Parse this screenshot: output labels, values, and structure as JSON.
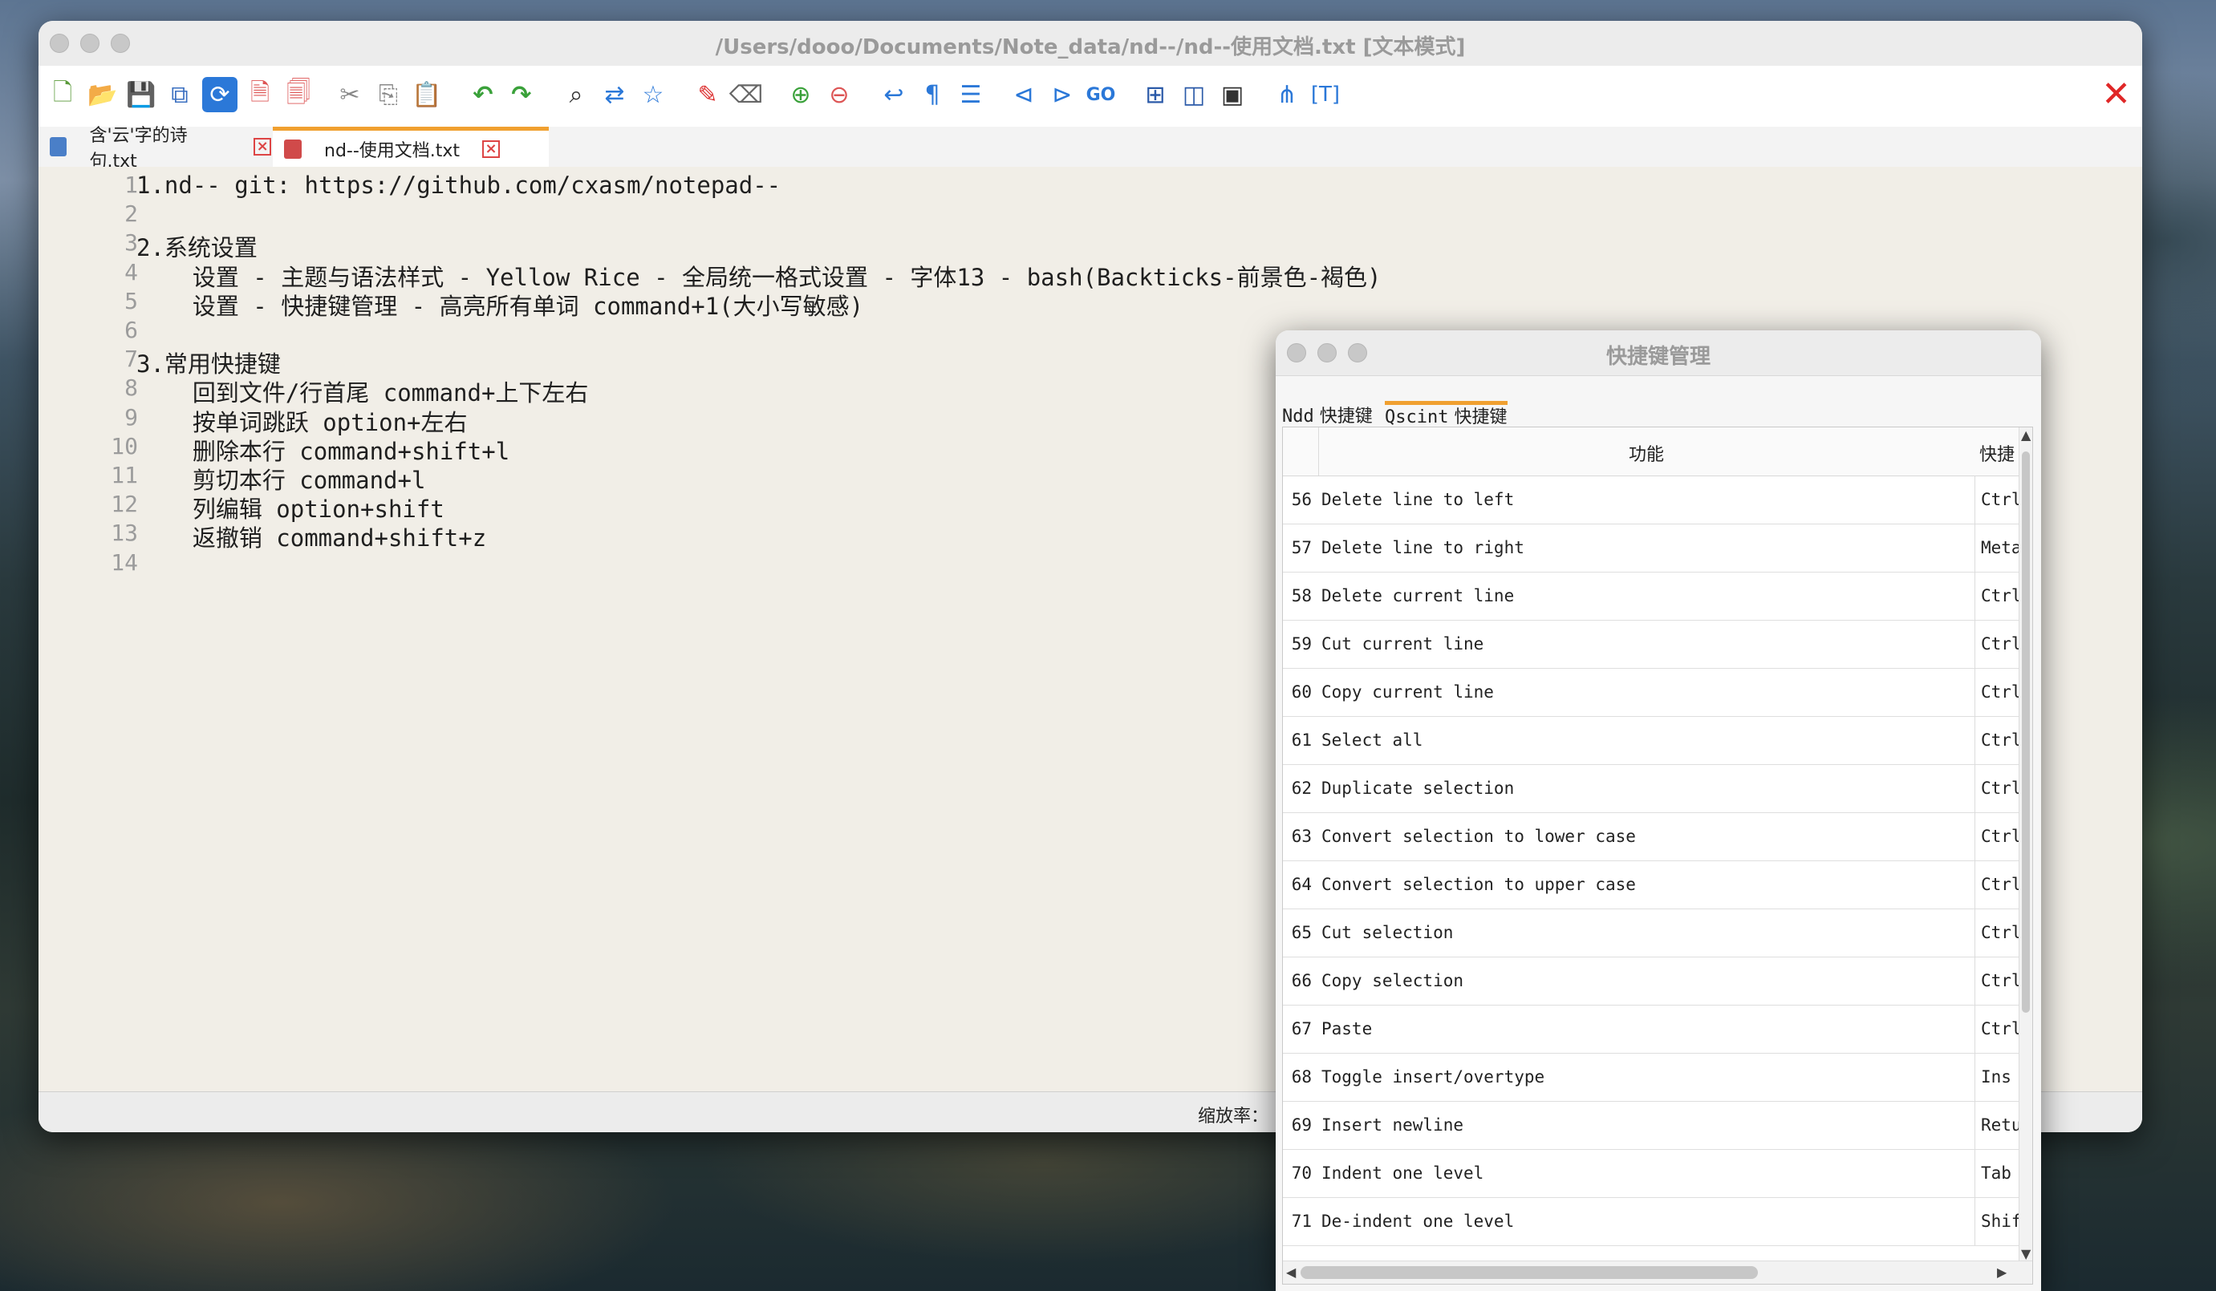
{
  "window": {
    "title": "/Users/dooo/Documents/Note_data/nd--/nd--使用文档.txt [文本模式]"
  },
  "tabs": [
    {
      "label": "含'云'字的诗句.txt"
    },
    {
      "label": "nd--使用文档.txt"
    }
  ],
  "editor": {
    "lines": [
      {
        "num": "1",
        "text": "1.nd-- git: https://github.com/cxasm/notepad--"
      },
      {
        "num": "2",
        "text": ""
      },
      {
        "num": "3",
        "text": "2.系统设置"
      },
      {
        "num": "4",
        "text": "    设置 - 主题与语法样式 - Yellow Rice - 全局统一格式设置 - 字体13 - bash(Backticks-前景色-褐色)"
      },
      {
        "num": "5",
        "text": "    设置 - 快捷键管理 - 高亮所有单词 command+1(大小写敏感)"
      },
      {
        "num": "6",
        "text": ""
      },
      {
        "num": "7",
        "text": "3.常用快捷键"
      },
      {
        "num": "8",
        "text": "    回到文件/行首尾 command+上下左右"
      },
      {
        "num": "9",
        "text": "    按单词跳跃 option+左右"
      },
      {
        "num": "10",
        "text": "    删除本行 command+shift+l"
      },
      {
        "num": "11",
        "text": "    剪切本行 command+l"
      },
      {
        "num": "12",
        "text": "    列编辑 option+shift"
      },
      {
        "num": "13",
        "text": "    返撤销 command+shift+z"
      },
      {
        "num": "14",
        "text": ""
      }
    ]
  },
  "status": {
    "zoom_label": "缩放率："
  },
  "dialog": {
    "title": "快捷键管理",
    "tab_ndd_a": "Ndd",
    "tab_ndd_b": "快捷键",
    "tab_qs_a": "Qscint",
    "tab_qs_b": "快捷键",
    "col_function": "功能",
    "col_shortcut": "快捷",
    "rows": [
      {
        "num": "56",
        "func": "Delete line to left",
        "key": "Ctrl+Shift"
      },
      {
        "num": "57",
        "func": "Delete line to right",
        "key": "Meta+K"
      },
      {
        "num": "58",
        "func": "Delete current line",
        "key": "Ctrl+Shift"
      },
      {
        "num": "59",
        "func": "Cut current line",
        "key": "Ctrl+L"
      },
      {
        "num": "60",
        "func": "Copy current line",
        "key": "Ctrl+Shift"
      },
      {
        "num": "61",
        "func": "Select all",
        "key": "Ctrl+A"
      },
      {
        "num": "62",
        "func": "Duplicate selection",
        "key": "Ctrl+D"
      },
      {
        "num": "63",
        "func": "Convert selection to lower case",
        "key": "Ctrl+U"
      },
      {
        "num": "64",
        "func": "Convert selection to upper case",
        "key": "Ctrl+Shift"
      },
      {
        "num": "65",
        "func": "Cut selection",
        "key": "Ctrl+X"
      },
      {
        "num": "66",
        "func": "Copy selection",
        "key": "Ctrl+C"
      },
      {
        "num": "67",
        "func": "Paste",
        "key": "Ctrl+V"
      },
      {
        "num": "68",
        "func": "Toggle insert/overtype",
        "key": "Ins"
      },
      {
        "num": "69",
        "func": "Insert newline",
        "key": "Return"
      },
      {
        "num": "70",
        "func": "Indent one level",
        "key": "Tab"
      },
      {
        "num": "71",
        "func": "De-indent one level",
        "key": "Shift+Tab"
      }
    ]
  },
  "toolbar": {
    "icons": [
      "new-file-icon",
      "open-folder-icon",
      "save-icon",
      "save-all-icon",
      "auto-save-icon",
      "close-file-icon",
      "close-all-icon",
      "cut-icon",
      "copy-icon",
      "paste-icon",
      "undo-icon",
      "redo-icon",
      "find-icon",
      "replace-icon",
      "bookmark-icon",
      "marker-icon",
      "eraser-icon",
      "zoom-in-icon",
      "zoom-out-icon",
      "word-wrap-icon",
      "pilcrow-icon",
      "indent-guide-icon",
      "prev-icon",
      "next-icon",
      "goto-icon",
      "compare-dir-icon",
      "compare-file-icon",
      "bin-view-icon",
      "tree-icon",
      "text-icon"
    ],
    "accent_color": "#2b78d8",
    "close_color": "#e02727"
  }
}
